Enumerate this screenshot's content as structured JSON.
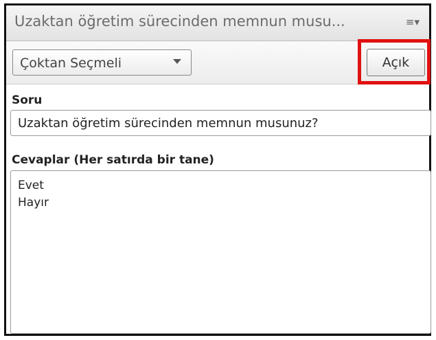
{
  "window": {
    "title": "Uzaktan öğretim sürecinden memnun musu...",
    "menu_icon_glyph": "≡▾"
  },
  "toolbar": {
    "question_type": "Çoktan Seçmeli",
    "open_button_label": "Açık",
    "highlight_color": "#e11111"
  },
  "form": {
    "question_label": "Soru",
    "question_value": "Uzaktan öğretim sürecinden memnun musunuz?",
    "answers_label": "Cevaplar (Her satırda bir tane)",
    "answers": [
      "Evet",
      "Hayır"
    ]
  }
}
